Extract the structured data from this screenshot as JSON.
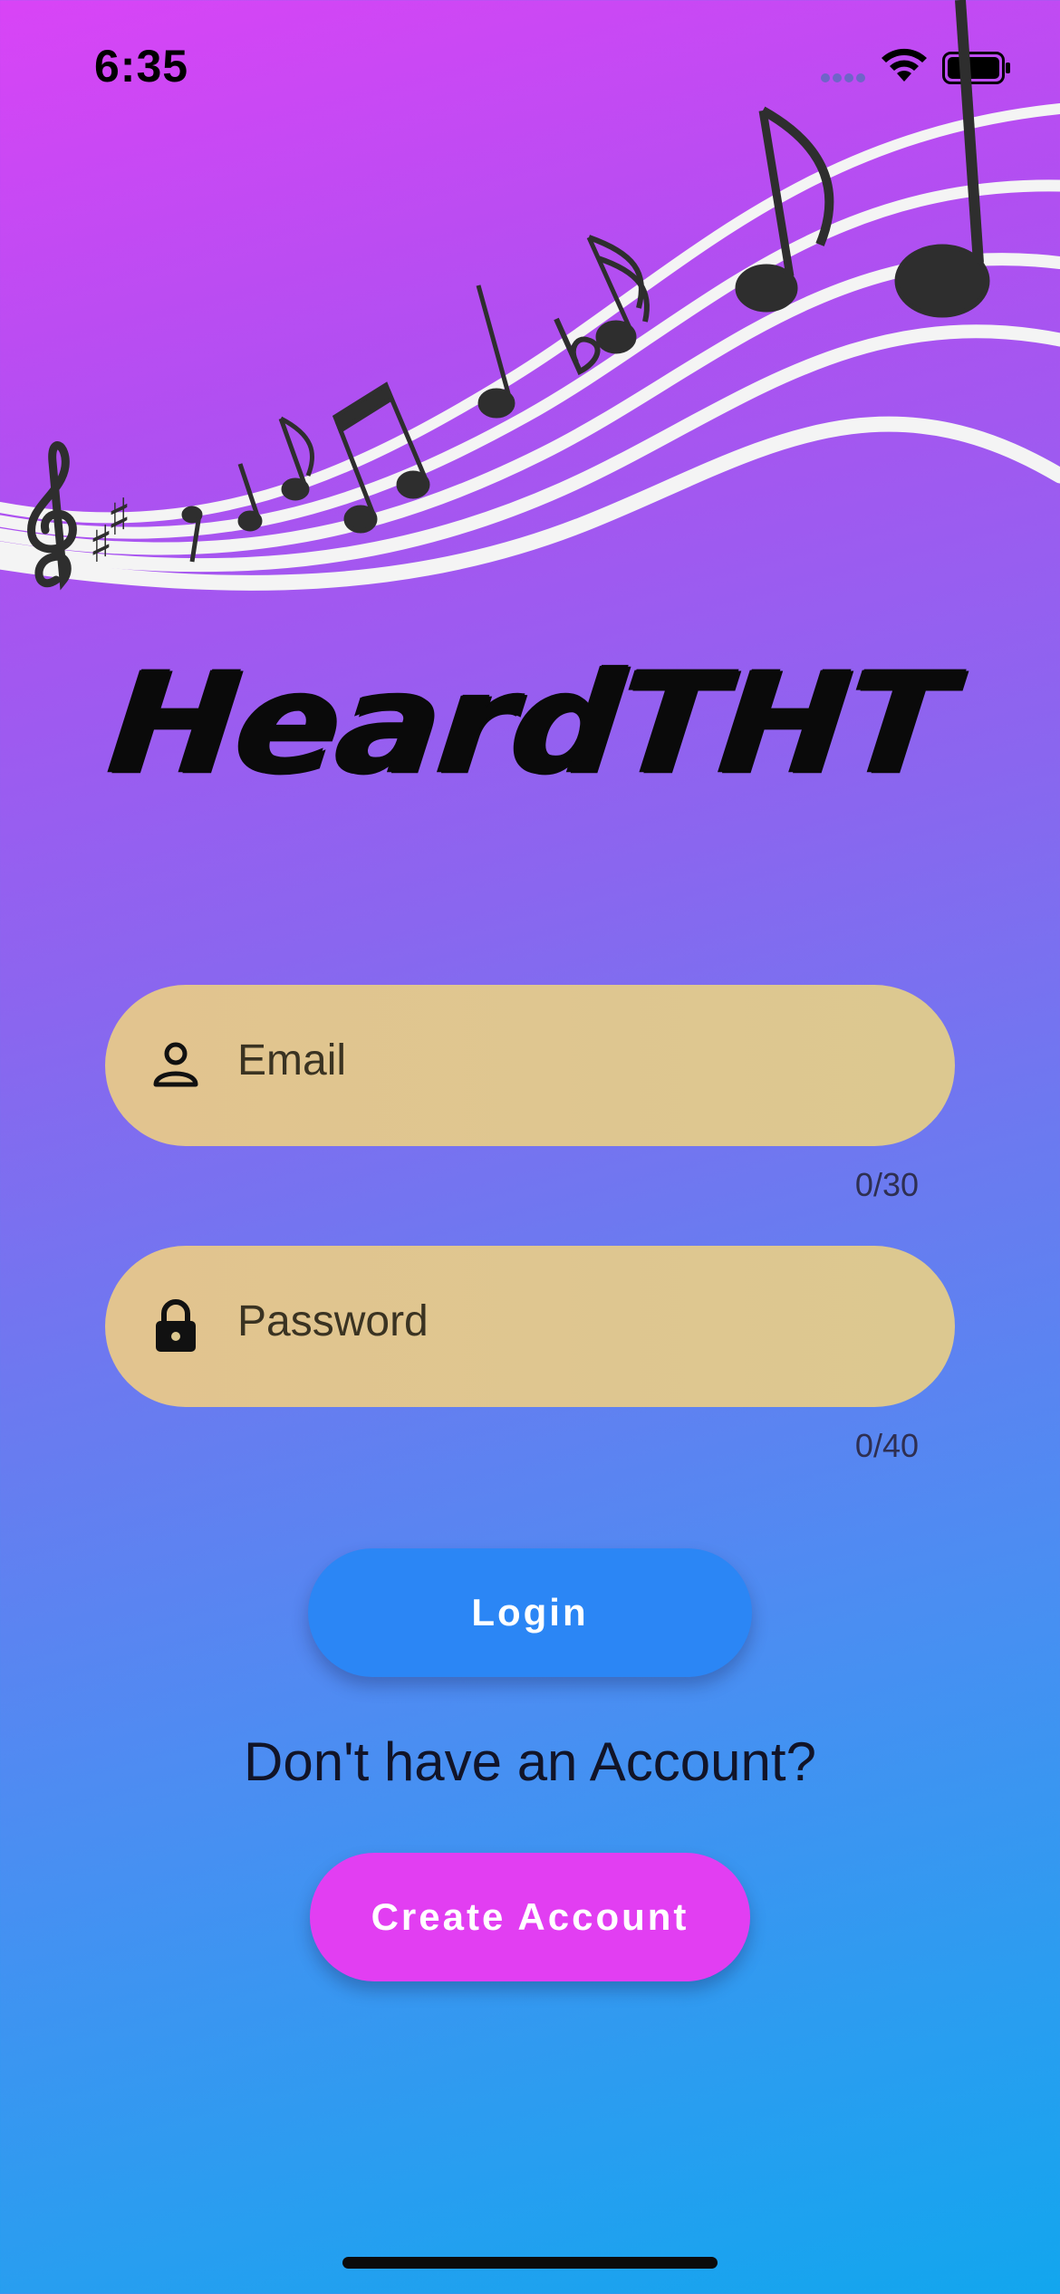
{
  "status_bar": {
    "time": "6:35",
    "icons": [
      "cellular-signal-icon",
      "wifi-icon",
      "battery-icon"
    ]
  },
  "header": {
    "art": "music-staff-with-notes",
    "logo_text": "HeardTHT"
  },
  "form": {
    "email": {
      "placeholder": "Email",
      "icon": "person-icon",
      "counter": "0/30"
    },
    "password": {
      "placeholder": "Password",
      "icon": "lock-icon",
      "counter": "0/40"
    }
  },
  "actions": {
    "login_label": "Login",
    "prompt": "Don't have an Account?",
    "create_account_label": "Create Account"
  },
  "colors": {
    "gradient_top": "#d944f6",
    "gradient_bottom": "#12a6ee",
    "field_fill": "#e0c68f",
    "login_button": "#2b86f5",
    "create_button": "#e23ef2"
  }
}
